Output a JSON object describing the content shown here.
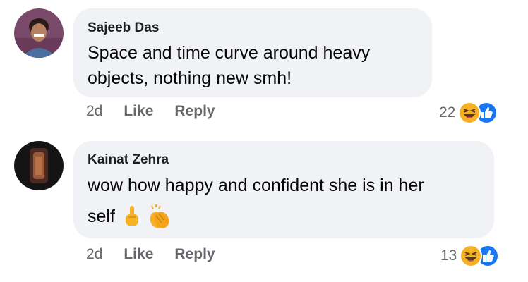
{
  "comments": [
    {
      "author": "Sajeeb Das",
      "text_lines": [
        "Space and time curve around heavy",
        "objects, nothing new smh!"
      ],
      "time": "2d",
      "like_label": "Like",
      "reply_label": "Reply",
      "reaction_count": "22",
      "reaction_icons": [
        "haha-icon",
        "like-icon"
      ]
    },
    {
      "author": "Kainat Zehra",
      "text_lines": [
        "wow how happy and confident she is in her",
        "self"
      ],
      "emojis": [
        "point-up-hand-icon",
        "clapping-hands-icon"
      ],
      "time": "2d",
      "like_label": "Like",
      "reply_label": "Reply",
      "reaction_count": "13",
      "reaction_icons": [
        "haha-icon",
        "like-icon"
      ]
    }
  ],
  "colors": {
    "bubble": "#f0f2f5",
    "meta_text": "#65676b",
    "like_blue": "#1877f2",
    "haha_yellow": "#f7b125"
  }
}
